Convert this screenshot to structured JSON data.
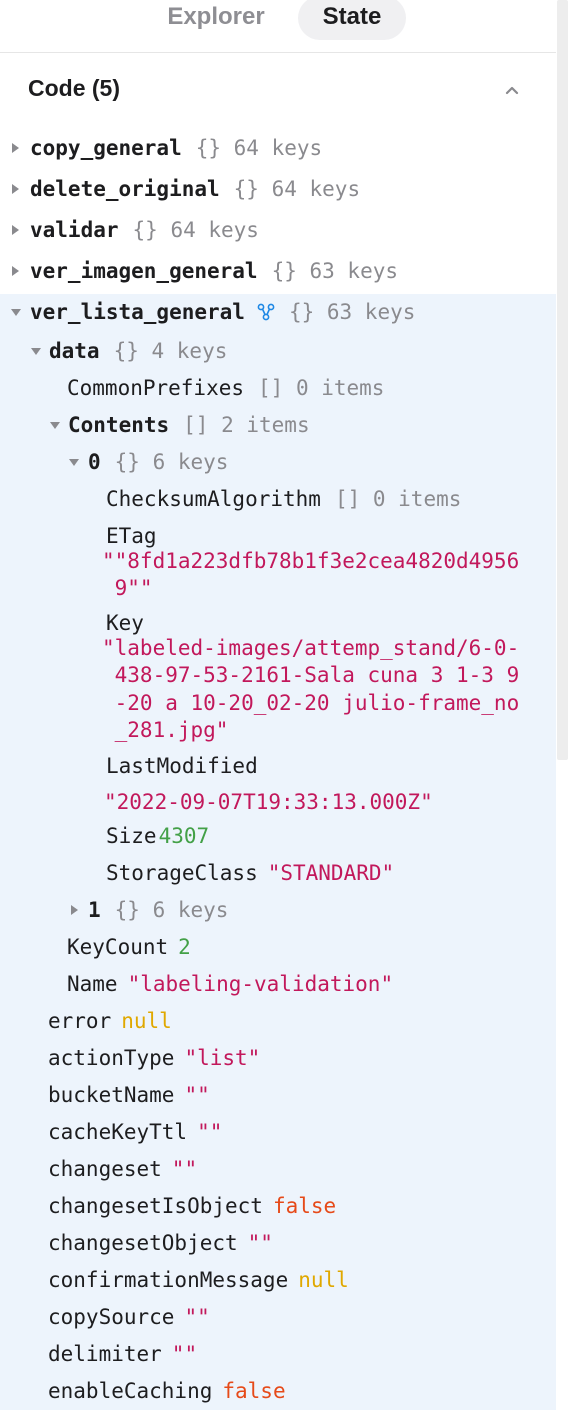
{
  "tabs": {
    "explorer": "Explorer",
    "state": "State"
  },
  "section": {
    "title": "Code (5)"
  },
  "queries": [
    {
      "name": "copy_general",
      "meta": "{} 64 keys"
    },
    {
      "name": "delete_original",
      "meta": "{} 64 keys"
    },
    {
      "name": "validar",
      "meta": "{} 64 keys"
    },
    {
      "name": "ver_imagen_general",
      "meta": "{} 63 keys"
    },
    {
      "name": "ver_lista_general",
      "meta": "{} 63 keys"
    }
  ],
  "tree": {
    "data": {
      "key": "data",
      "meta": "{} 4 keys"
    },
    "common_prefixes": {
      "key": "CommonPrefixes",
      "meta": "[] 0 items"
    },
    "contents": {
      "key": "Contents",
      "meta": "[] 2 items"
    },
    "item0": {
      "key": "0",
      "meta": "{} 6 keys"
    },
    "checksum": {
      "key": "ChecksumAlgorithm",
      "meta": "[] 0 items"
    },
    "etag": {
      "key": "ETag",
      "lines": [
        "\"\"8fd1a223dfb78b1f3e2cea4820d4956",
        " 9\"\""
      ]
    },
    "key_field": {
      "key": "Key",
      "lines": [
        "\"labeled-images/attemp_stand/6-0-",
        " 438-97-53-2161-Sala cuna 3 1-3 9",
        " -20 a 10-20_02-20 julio-frame_no",
        " _281.jpg\""
      ]
    },
    "last_modified": {
      "key": "LastModified",
      "value": "\"2022-09-07T19:33:13.000Z\""
    },
    "size": {
      "key": "Size",
      "value": "4307"
    },
    "storage_class": {
      "key": "StorageClass",
      "value": "\"STANDARD\""
    },
    "item1": {
      "key": "1",
      "meta": "{} 6 keys"
    },
    "key_count": {
      "key": "KeyCount",
      "value": "2"
    },
    "name": {
      "key": "Name",
      "value": "\"labeling-validation\""
    }
  },
  "props": [
    {
      "key": "error",
      "value": "null",
      "type": "nul"
    },
    {
      "key": "actionType",
      "value": "\"list\"",
      "type": "str"
    },
    {
      "key": "bucketName",
      "value": "\"\"",
      "type": "str"
    },
    {
      "key": "cacheKeyTtl",
      "value": "\"\"",
      "type": "str"
    },
    {
      "key": "changeset",
      "value": "\"\"",
      "type": "str"
    },
    {
      "key": "changesetIsObject",
      "value": "false",
      "type": "bool"
    },
    {
      "key": "changesetObject",
      "value": "\"\"",
      "type": "str"
    },
    {
      "key": "confirmationMessage",
      "value": "null",
      "type": "nul"
    },
    {
      "key": "copySource",
      "value": "\"\"",
      "type": "str"
    },
    {
      "key": "delimiter",
      "value": "\"\"",
      "type": "str"
    },
    {
      "key": "enableCaching",
      "value": "false",
      "type": "bool"
    }
  ],
  "colors": {
    "panel": "#edf4fc",
    "string": "#c2185b",
    "number": "#43a047",
    "boolean": "#e64a19",
    "null": "#e0a800",
    "meta": "#8a8a8e",
    "query_icon": "#1e88e5"
  },
  "icons": {
    "collapse": "chevron-up-icon",
    "collapsed": "caret-right-icon",
    "expanded": "caret-down-icon",
    "query": "query-graph-icon"
  }
}
